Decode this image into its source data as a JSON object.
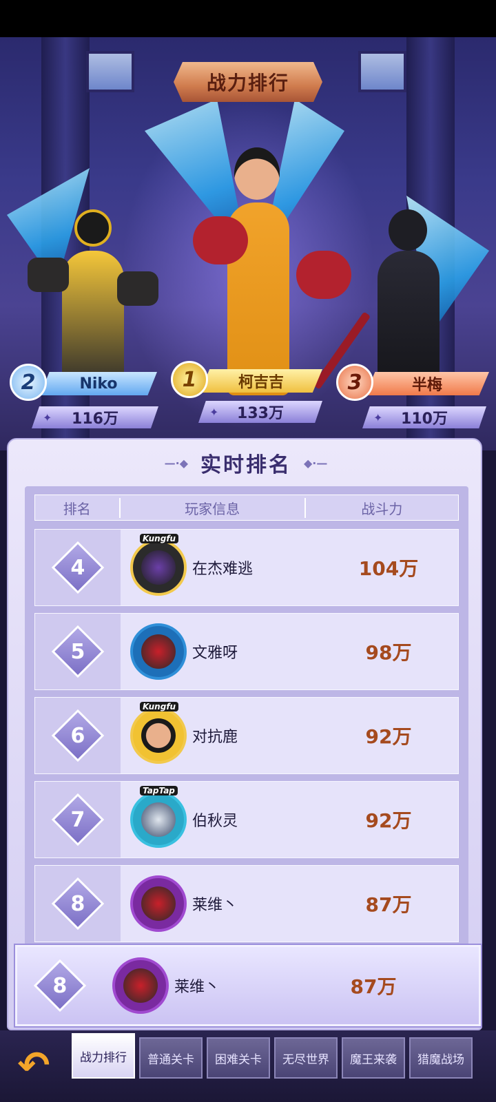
{
  "title": "战力排行",
  "podium": [
    {
      "rank": "1",
      "name": "柯吉吉",
      "power": "133万"
    },
    {
      "rank": "2",
      "name": "Niko",
      "power": "116万"
    },
    {
      "rank": "3",
      "name": "半梅",
      "power": "110万"
    }
  ],
  "ranking": {
    "title": "实时排名",
    "headers": {
      "rank": "排名",
      "player": "玩家信息",
      "power": "战斗力"
    },
    "rows": [
      {
        "rank": "4",
        "name": "在杰难逃",
        "power": "104万",
        "badge": "Kungfu"
      },
      {
        "rank": "5",
        "name": "文雅呀",
        "power": "98万",
        "badge": ""
      },
      {
        "rank": "6",
        "name": "对抗鹿",
        "power": "92万",
        "badge": "Kungfu"
      },
      {
        "rank": "7",
        "name": "伯秋灵",
        "power": "92万",
        "badge": "TapTap"
      },
      {
        "rank": "8",
        "name": "莱维丶",
        "power": "87万",
        "badge": ""
      }
    ],
    "me": {
      "rank": "8",
      "name": "莱维丶",
      "power": "87万"
    }
  },
  "tabs": [
    {
      "label": "战力排行",
      "active": true
    },
    {
      "label": "普通关卡",
      "active": false
    },
    {
      "label": "困难关卡",
      "active": false
    },
    {
      "label": "无尽世界",
      "active": false
    },
    {
      "label": "魔王来袭",
      "active": false
    },
    {
      "label": "猎魔战场",
      "active": false
    }
  ],
  "icons": {
    "back": "back-arrow-icon",
    "power": "sparkle-icon"
  },
  "colors": {
    "power_text": "#a54a1e",
    "accent": "#7c70c6"
  }
}
